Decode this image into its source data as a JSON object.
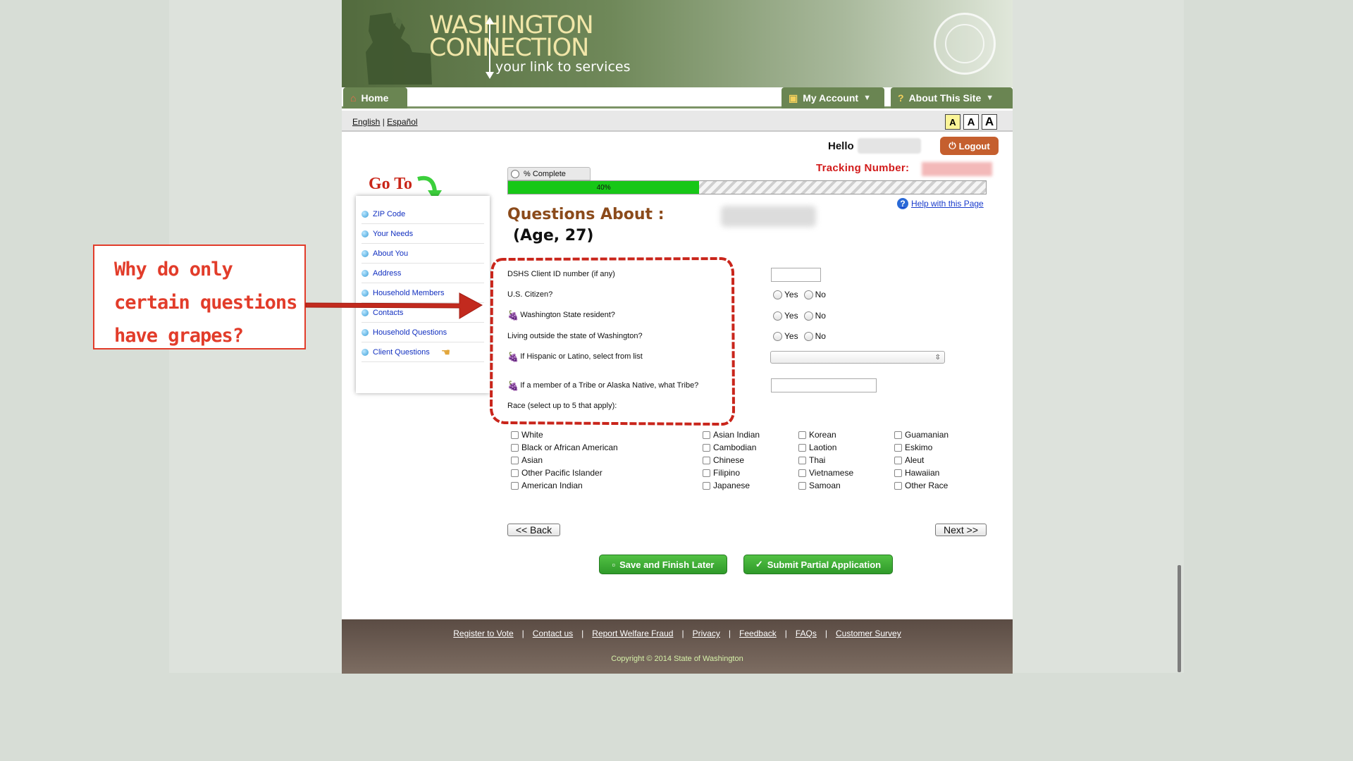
{
  "header": {
    "logo_line1": "WASHINGTON",
    "logo_line2": "CONNECTION",
    "logo_tagline": "your link to services"
  },
  "nav": {
    "home": "Home",
    "my_account": "My Account",
    "about_site": "About This Site"
  },
  "language": {
    "english": "English",
    "separator": "|",
    "spanish": "Español",
    "font_sizes": [
      "A",
      "A",
      "A"
    ]
  },
  "user": {
    "hello": "Hello",
    "logout": "Logout",
    "tracking_label": "Tracking Number:"
  },
  "progress": {
    "tab_label": "% Complete",
    "value_label": "40%",
    "percent": 40
  },
  "help_link": "Help with this Page",
  "goto": {
    "label": "Go To",
    "items": [
      "ZIP Code",
      "Your Needs",
      "About You",
      "Address",
      "Household Members",
      "Contacts",
      "Household Questions",
      "Client Questions"
    ]
  },
  "questions": {
    "title": "Questions About :",
    "age": "(Age, 27)",
    "client_id": "DSHS Client ID number (if any)",
    "us_citizen": "U.S. Citizen?",
    "wa_resident": "Washington State resident?",
    "outside_wa": "Living outside the state of Washington?",
    "hispanic": "If Hispanic or Latino, select from list",
    "tribe": "If a member of a Tribe or Alaska Native, what Tribe?",
    "race": "Race (select up to 5 that apply):",
    "yes": "Yes",
    "no": "No"
  },
  "race_options": {
    "col1": [
      "White",
      "Black or African American",
      "Asian",
      "Other Pacific Islander",
      "American Indian"
    ],
    "col2": [
      "Asian Indian",
      "Cambodian",
      "Chinese",
      "Filipino",
      "Japanese"
    ],
    "col3": [
      "Korean",
      "Laotion",
      "Thai",
      "Vietnamese",
      "Samoan"
    ],
    "col4": [
      "Guamanian",
      "Eskimo",
      "Aleut",
      "Hawaiian",
      "Other Race"
    ]
  },
  "buttons": {
    "back": "<< Back",
    "next": "Next >>",
    "save_later": "Save and Finish Later",
    "submit_partial": "Submit Partial Application"
  },
  "footer": {
    "links": [
      "Register to Vote",
      "Contact us",
      "Report Welfare Fraud",
      "Privacy",
      "Feedback",
      "FAQs",
      "Customer Survey"
    ],
    "separator": "|",
    "copyright": "Copyright © 2014 State of Washington"
  },
  "annotation": {
    "line1": "Why do only",
    "line2": "certain questions",
    "line3": "have grapes?",
    "color": "#e23c2a"
  },
  "colors": {
    "nav_green": "#6a8552",
    "progress_green": "#17c717",
    "title_brown": "#8b4a1a",
    "link_blue": "#1230c0",
    "tracking_red": "#d21b1b"
  }
}
